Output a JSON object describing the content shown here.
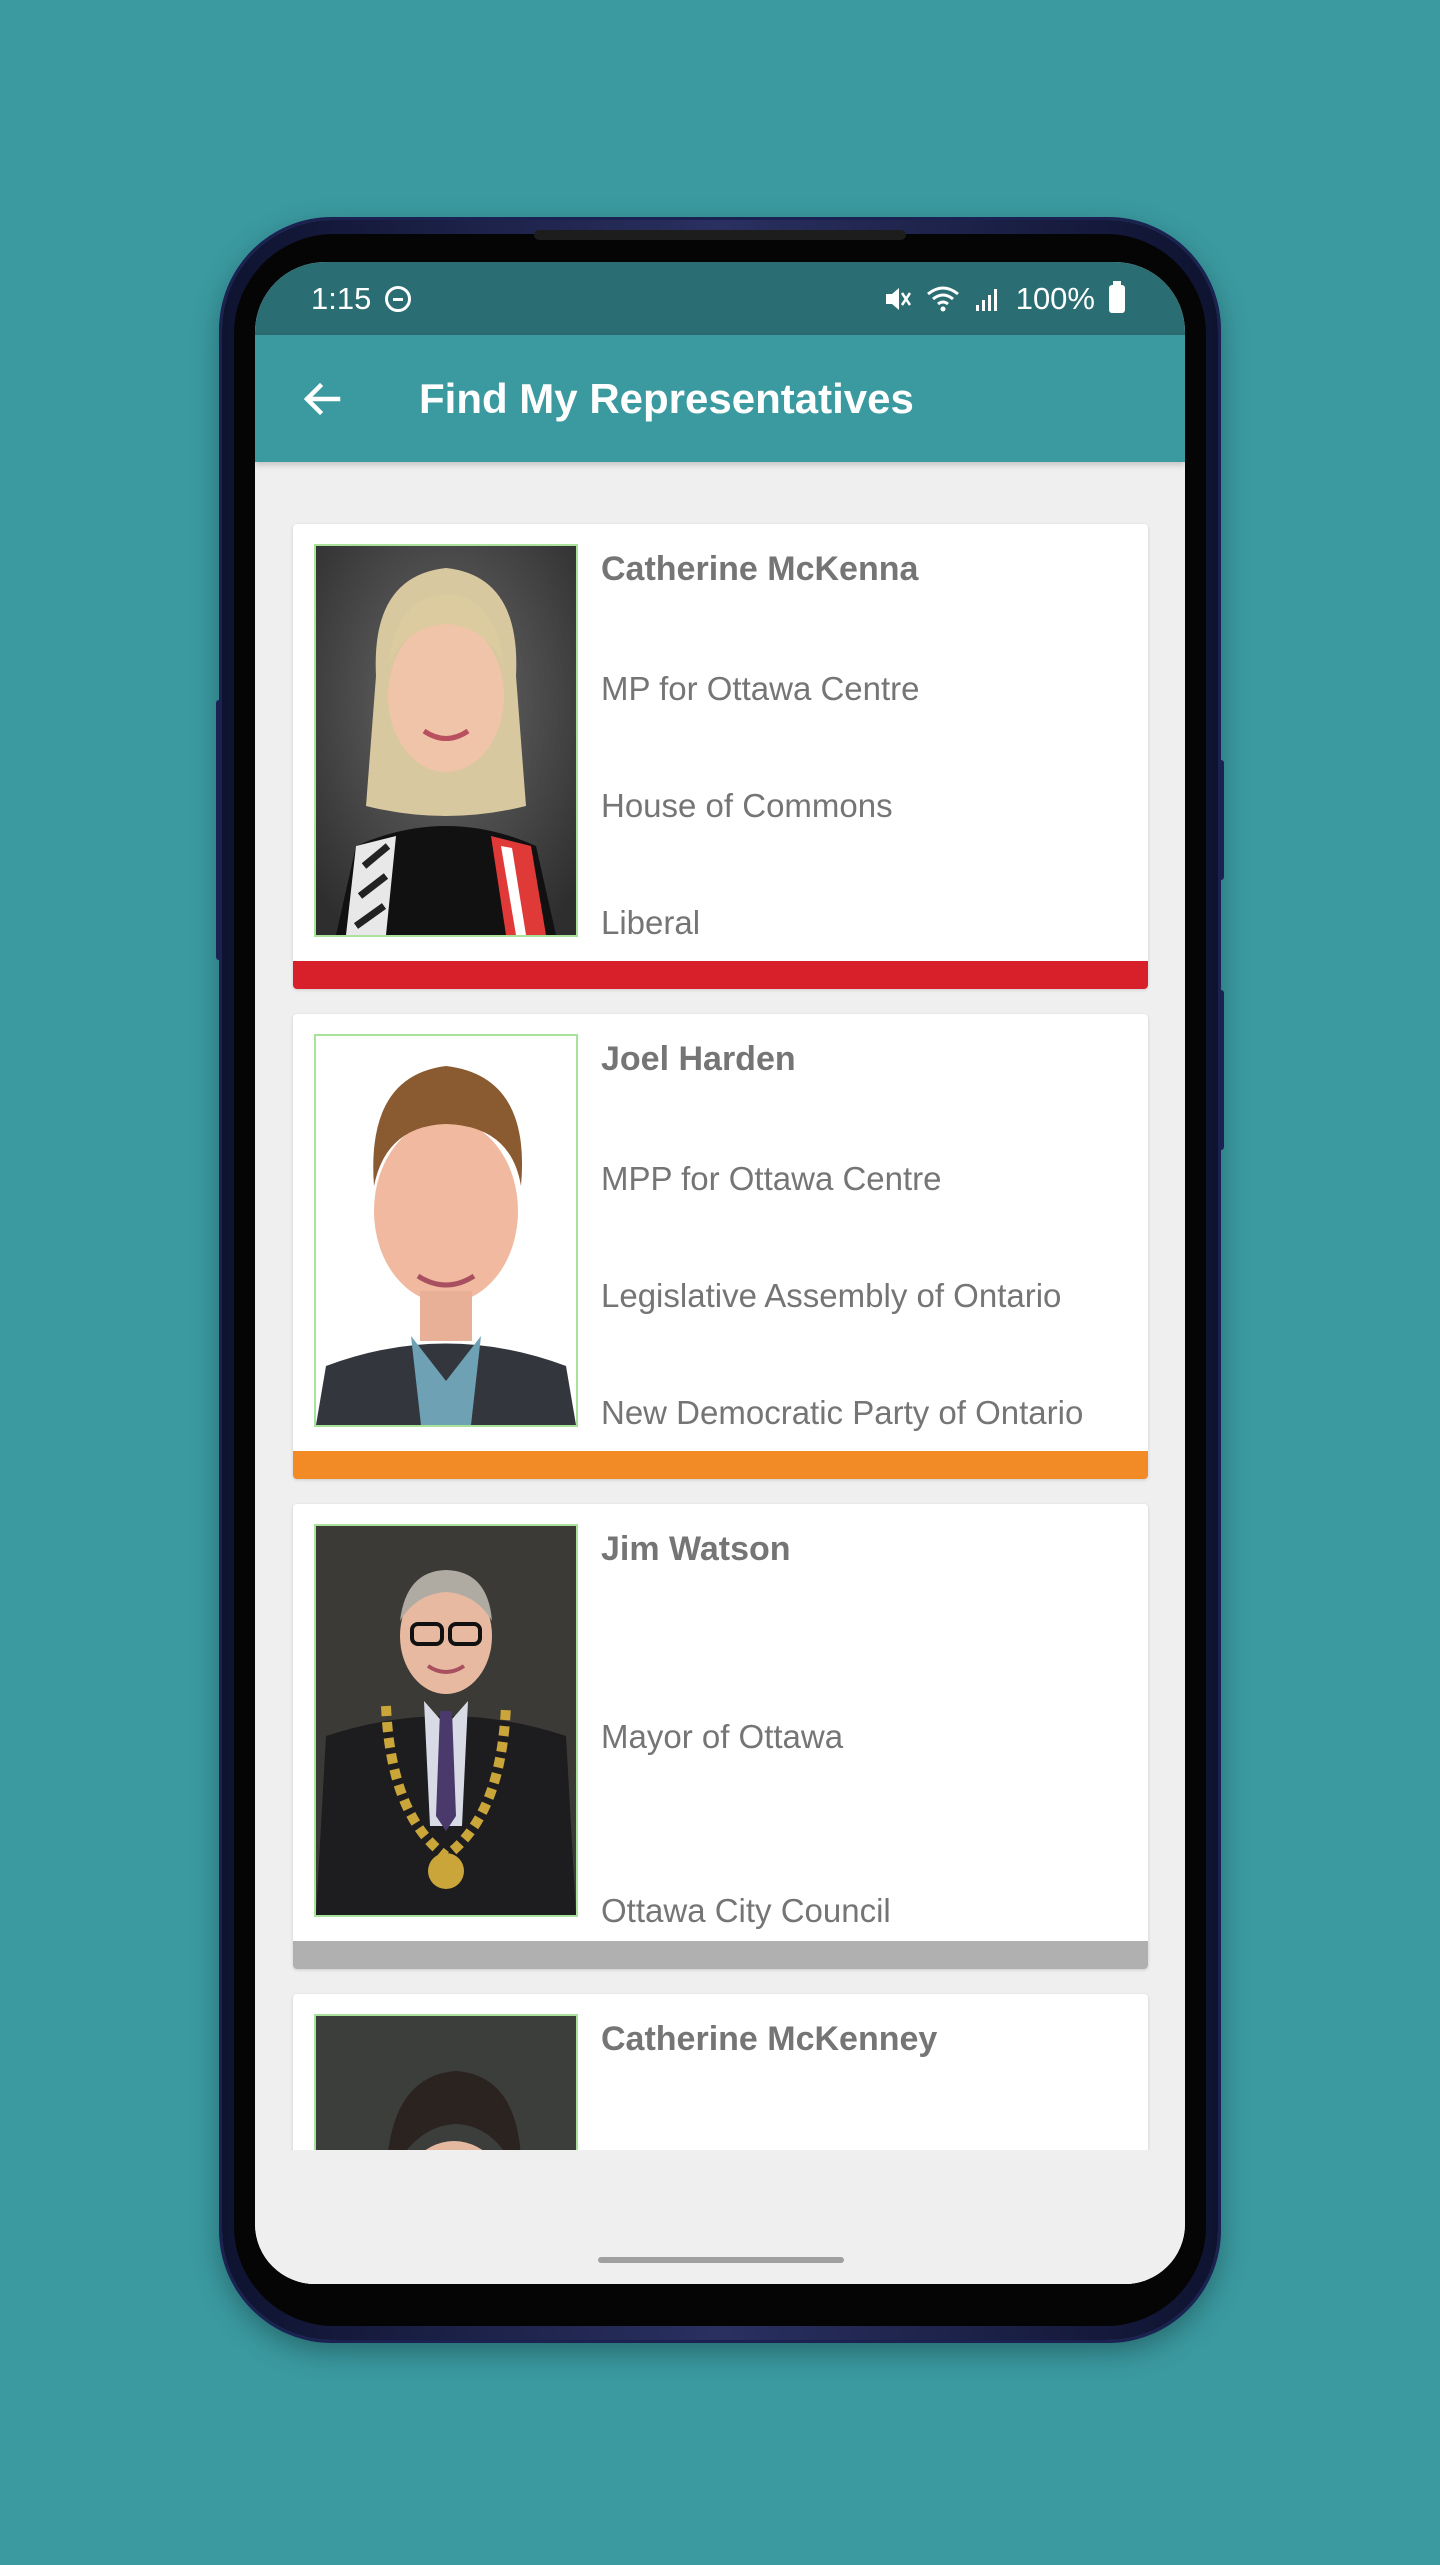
{
  "status_bar": {
    "time": "1:15",
    "battery": "100%",
    "icons": [
      "do-not-disturb-icon",
      "mute-icon",
      "wifi-icon",
      "signal-icon",
      "battery-icon"
    ]
  },
  "app_bar": {
    "title": "Find My Representatives",
    "back_icon": "arrow-left-icon"
  },
  "colors": {
    "background": "#3a9aa0",
    "app_bar": "#3a9aa0",
    "status_bar": "#2a6d72",
    "liberal": "#d8202a",
    "ndp": "#f28a25",
    "municipal": "#b0b0b0"
  },
  "representatives": [
    {
      "name": "Catherine McKenna",
      "role": "MP for Ottawa Centre",
      "body": "House of Commons",
      "party": "Liberal",
      "party_color": "#d8202a"
    },
    {
      "name": "Joel Harden",
      "role": "MPP for Ottawa Centre",
      "body": "Legislative Assembly of Ontario",
      "party": "New Democratic Party of Ontario",
      "party_color": "#f28a25"
    },
    {
      "name": "Jim Watson",
      "role": "Mayor of Ottawa",
      "body": "Ottawa City Council",
      "party_color": "#b0b0b0"
    },
    {
      "name": "Catherine McKenney"
    }
  ]
}
